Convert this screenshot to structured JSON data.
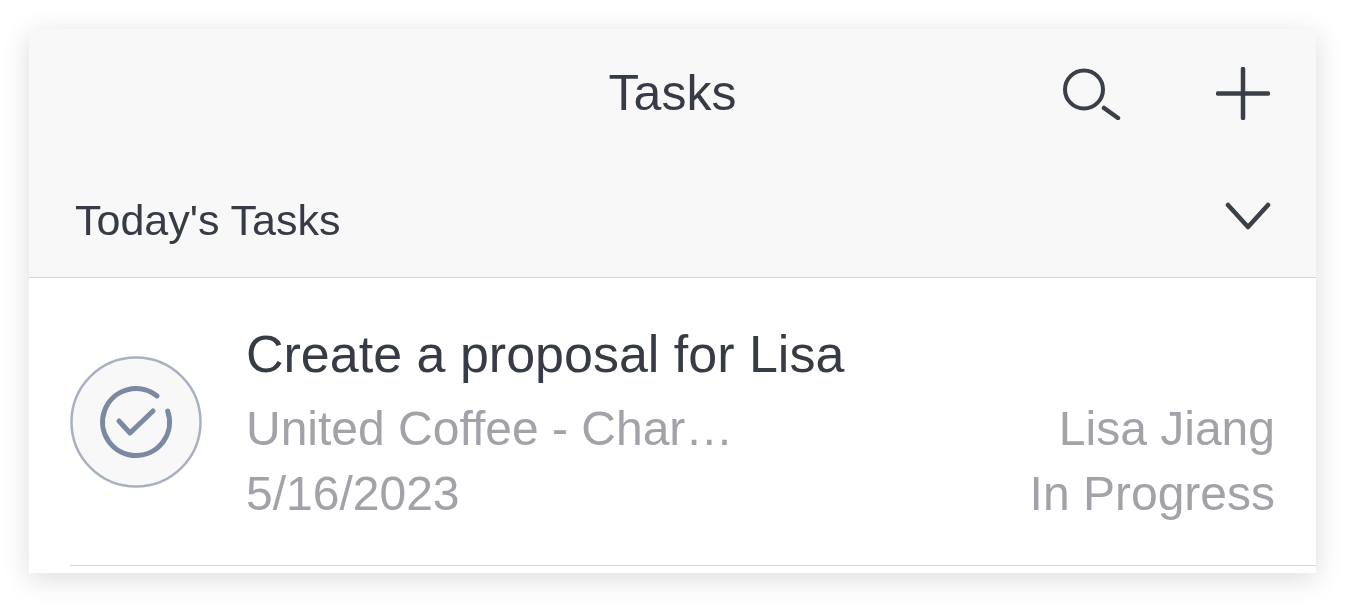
{
  "header": {
    "title": "Tasks"
  },
  "section": {
    "title": "Today's Tasks",
    "expanded": true
  },
  "tasks": [
    {
      "title": "Create a proposal for Lisa",
      "account": "United Coffee - Char…",
      "date": "5/16/2023",
      "owner": "Lisa Jiang",
      "status": "In Progress"
    }
  ]
}
